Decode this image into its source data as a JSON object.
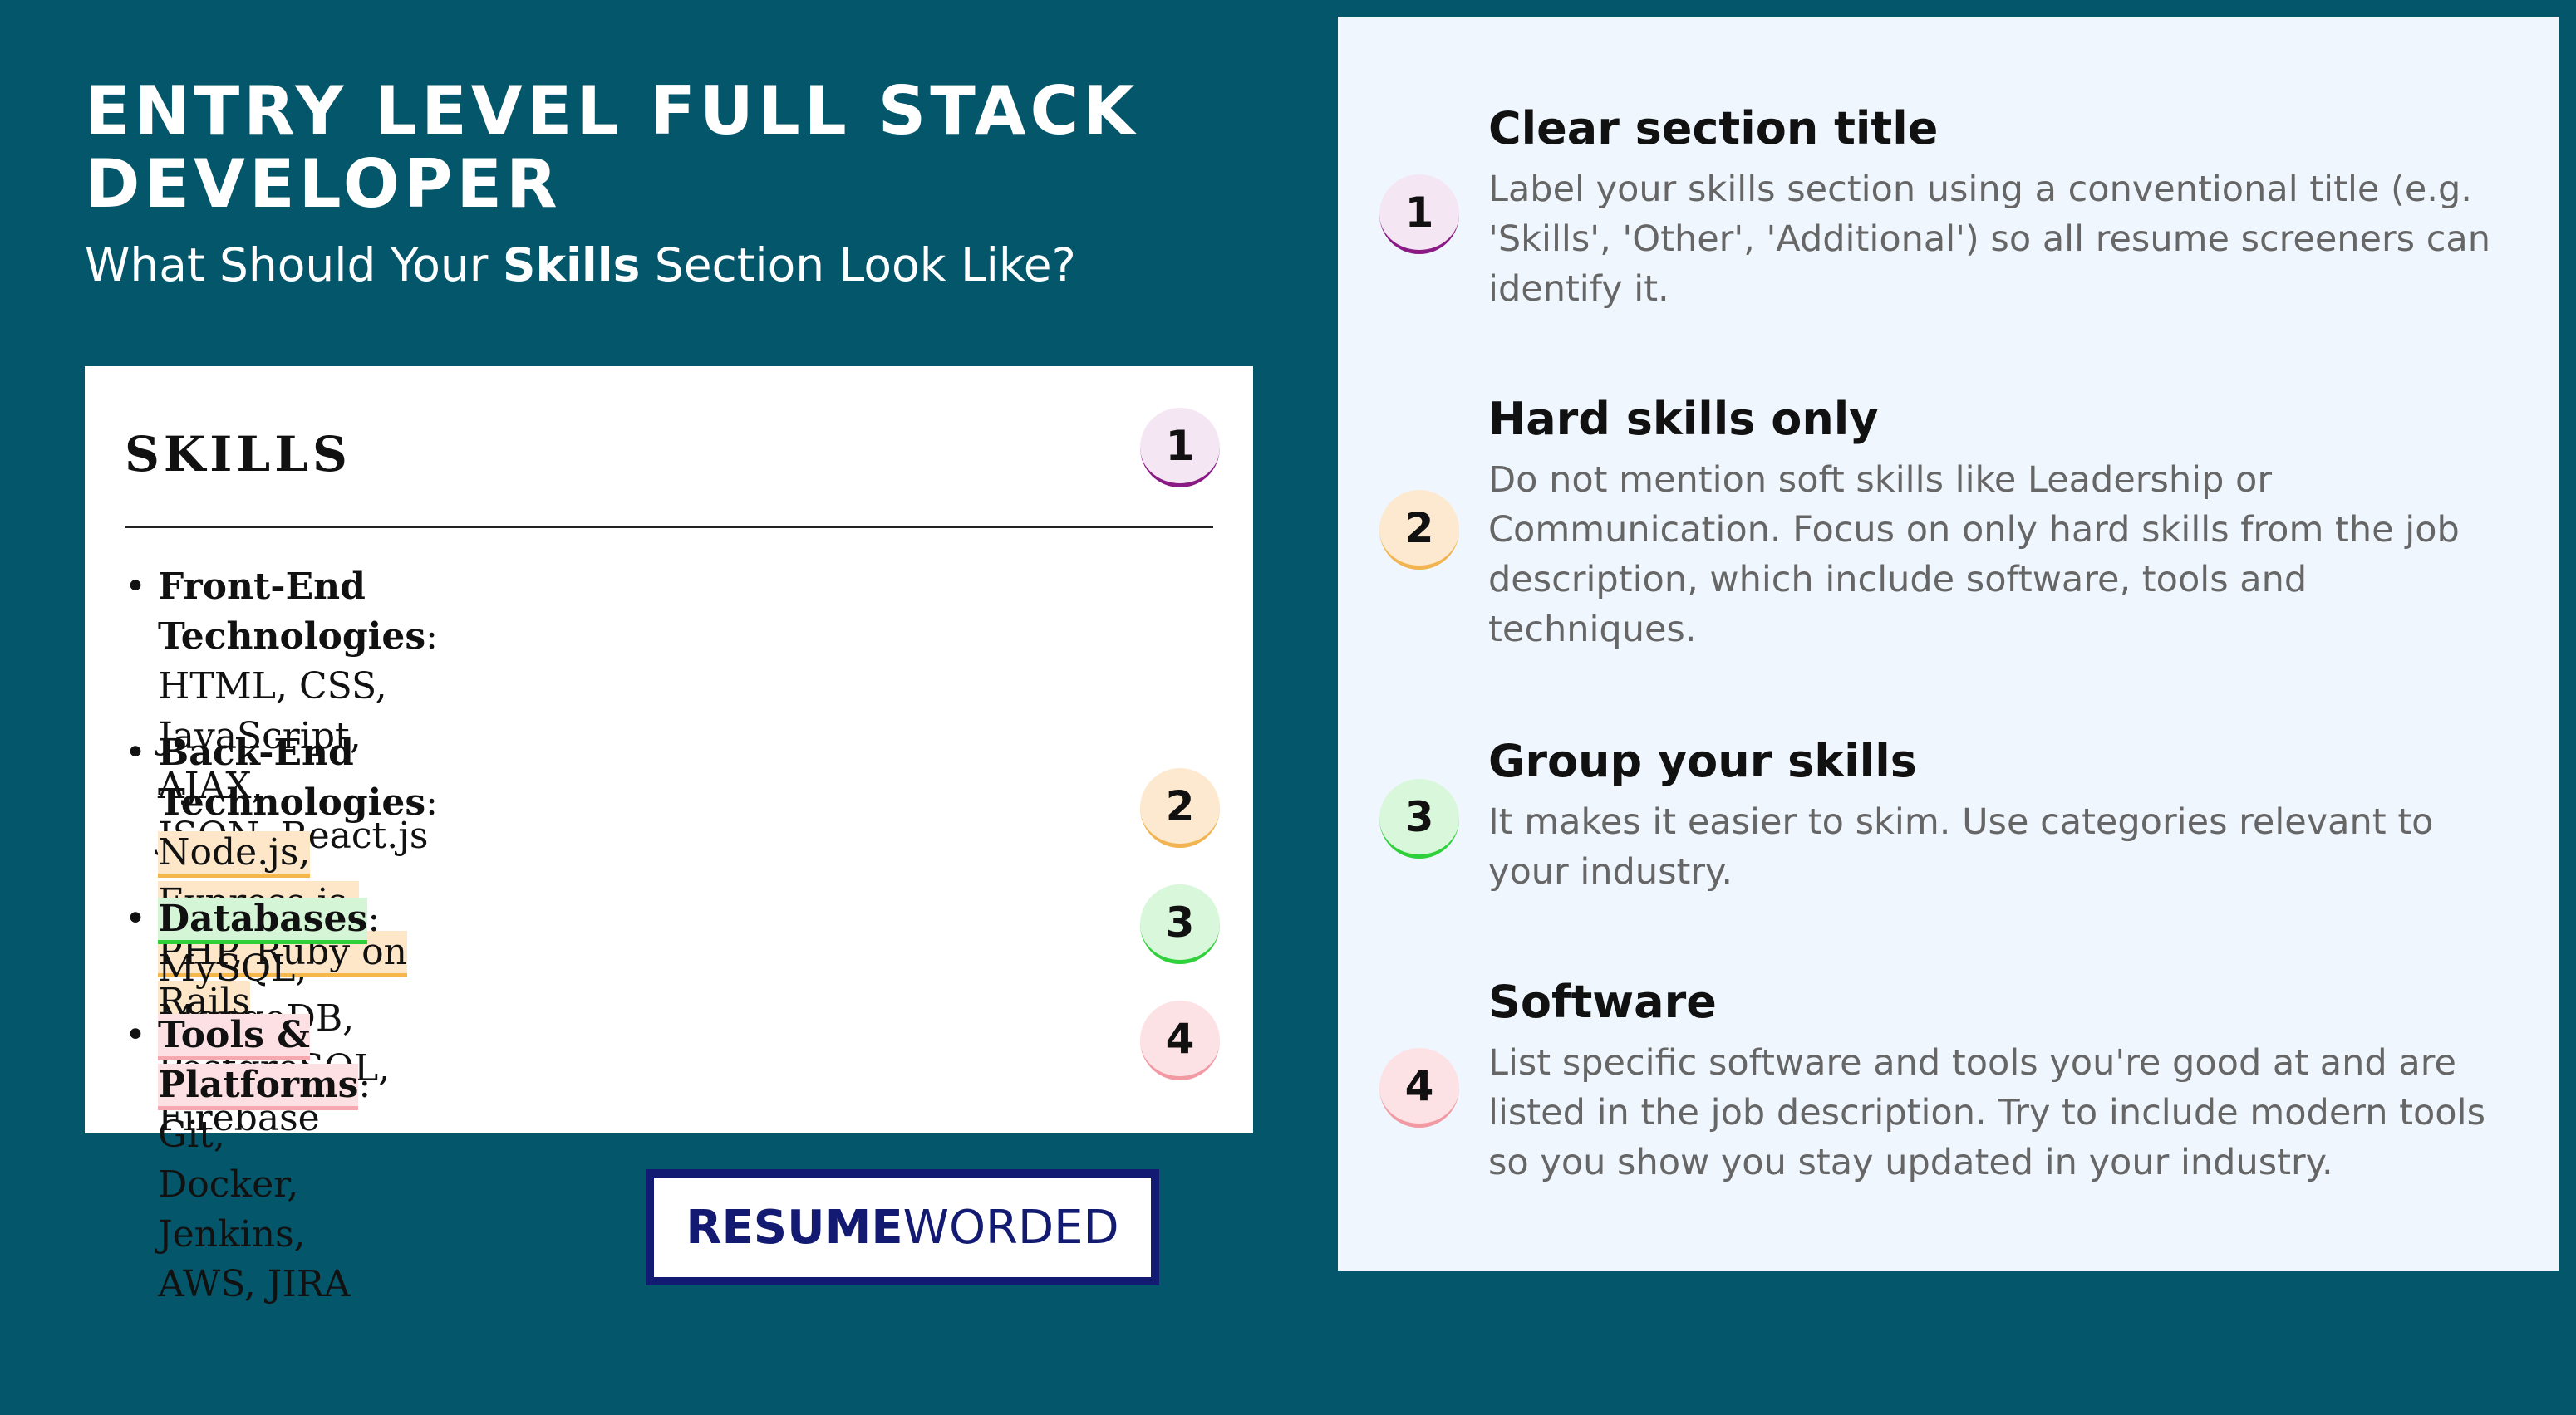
{
  "header": {
    "title": "ENTRY LEVEL FULL STACK DEVELOPER",
    "subtitle_before": "What Should Your ",
    "subtitle_bold": "Skills",
    "subtitle_after": " Section Look Like?"
  },
  "resume": {
    "section_heading": "SKILLS",
    "heading_badge": "1",
    "skills": [
      {
        "category": "Front-End Technologies",
        "separator": ":",
        "items": " HTML, CSS, JavaScript, AJAX,",
        "items_line2": "JSON, React.js",
        "badge": ""
      },
      {
        "category": "Back-End Technologies",
        "separator": ": ",
        "items": "Node.js, Express.js, PHP, Ruby on",
        "items_line2": "Rails",
        "badge": "2"
      },
      {
        "category": "Databases",
        "separator": ":",
        "items": " MySQL, MongoDB, PostgreSQL, Firebase",
        "badge": "3"
      },
      {
        "category": "Tools & Platforms",
        "separator": ":",
        "items": " Git, Docker, Jenkins, AWS, JIRA",
        "badge": "4"
      }
    ]
  },
  "logo": {
    "bold": "RESUME",
    "light": " WORDED"
  },
  "tips": [
    {
      "number": "1",
      "title": "Clear section title",
      "body": "Label your skills section using a conventional title (e.g. 'Skills', 'Other', 'Additional') so all resume screeners can identify it."
    },
    {
      "number": "2",
      "title": "Hard skills only",
      "body": "Do not mention soft skills like Leadership or Communication. Focus on only hard skills from the job description, which include software, tools and techniques."
    },
    {
      "number": "3",
      "title": "Group your skills",
      "body": "It makes it easier to skim. Use categories relevant to your industry."
    },
    {
      "number": "4",
      "title": "Software",
      "body": "List specific software and tools you're good at and are listed in the job description. Try to include modern tools so you show you stay updated in your industry."
    }
  ],
  "colors": {
    "background": "#04566a",
    "badge_1": "#8a1b84",
    "badge_2": "#f2b451",
    "badge_3": "#2fd13a",
    "badge_4": "#f29aa3",
    "logo_navy": "#121a72"
  }
}
